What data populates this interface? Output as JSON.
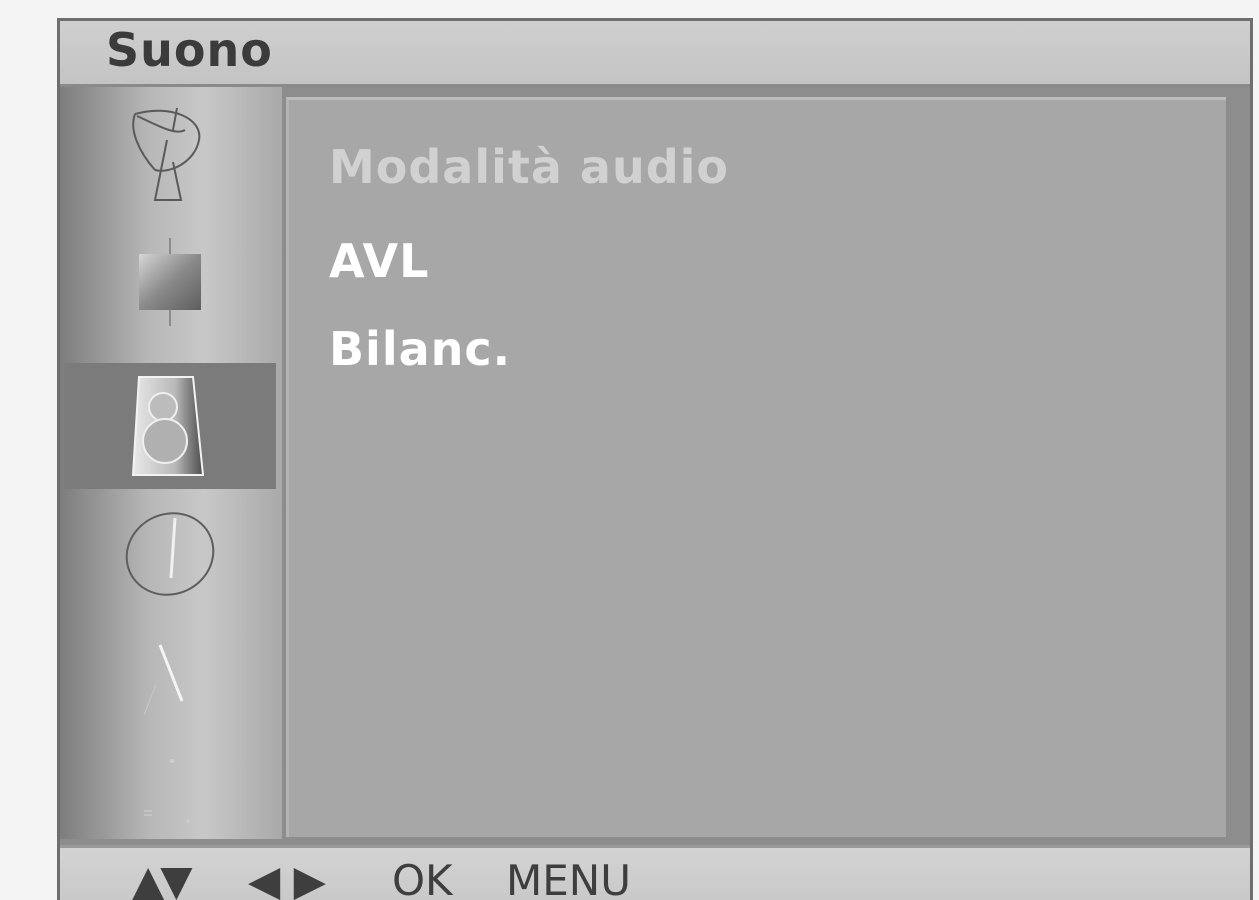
{
  "header": {
    "title": "Suono"
  },
  "sidebar": {
    "items": [
      {
        "icon": "satellite-dish-icon",
        "selected": false
      },
      {
        "icon": "picture-icon",
        "selected": false
      },
      {
        "icon": "speaker-icon",
        "selected": true
      },
      {
        "icon": "clock-icon",
        "selected": false
      },
      {
        "icon": "setup-icon",
        "selected": false
      },
      {
        "icon": "option-icon",
        "selected": false
      }
    ]
  },
  "menu": {
    "items": [
      {
        "label": "Modalità audio"
      },
      {
        "label": "AVL"
      },
      {
        "label": "Bilanc."
      }
    ]
  },
  "footer": {
    "updown": "▲▼",
    "leftright": "◀ ▶",
    "ok": "OK",
    "menu": "MENU"
  },
  "colors": {
    "panel": "#8d8d8d",
    "content": "#a7a7a7",
    "selected_tab": "#7b7b7b",
    "text": "#ffffff",
    "dim_text": "#d1d1d1"
  }
}
